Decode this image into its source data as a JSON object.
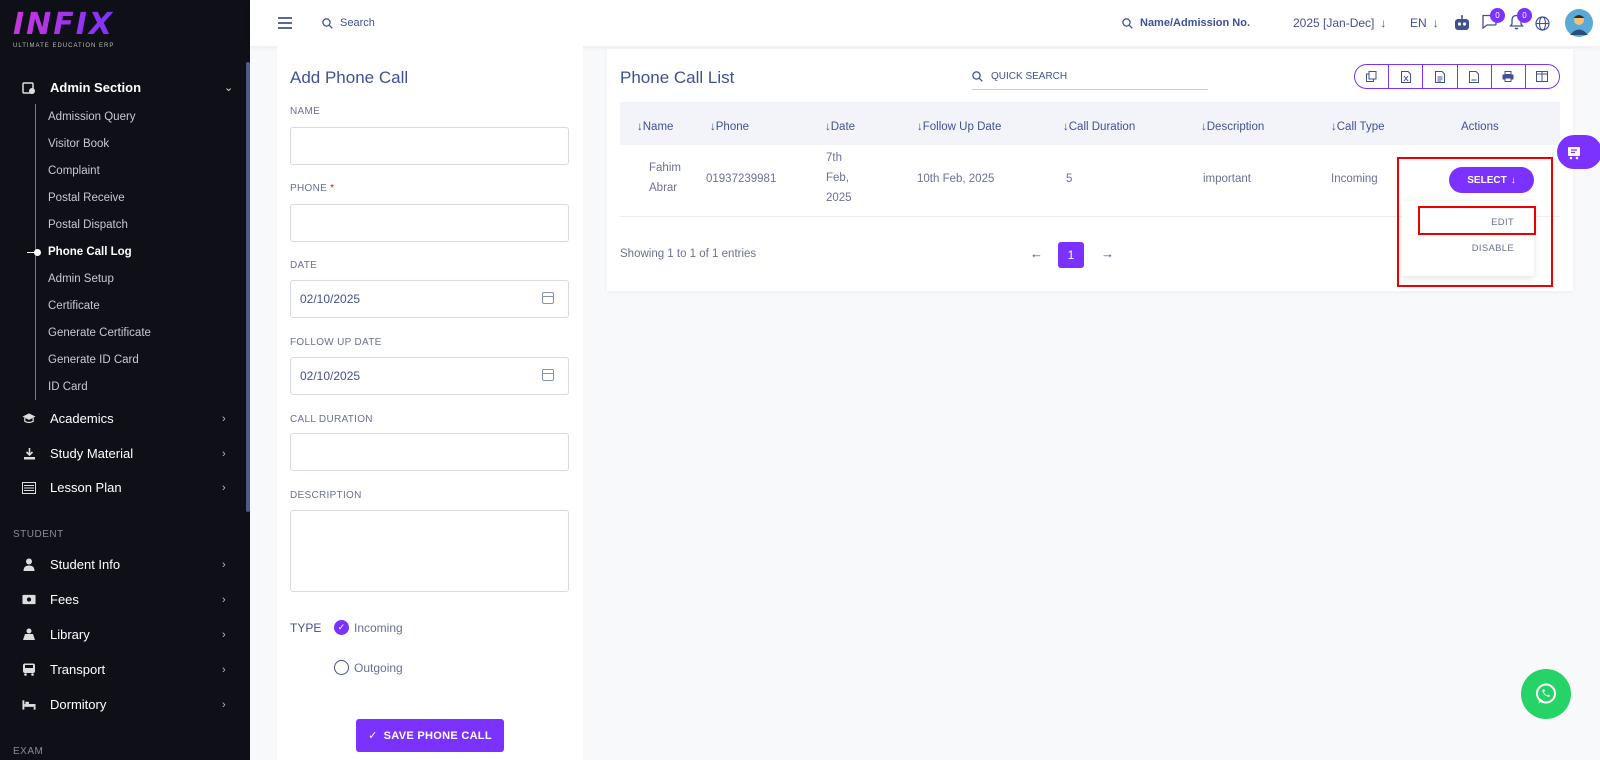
{
  "brand": {
    "logo_text": "INFIX",
    "tagline": "ULTIMATE EDUCATION ERP"
  },
  "sidebar": {
    "admin_section": "Admin Section",
    "admin_items": [
      "Admission Query",
      "Visitor Book",
      "Complaint",
      "Postal Receive",
      "Postal Dispatch",
      "Phone Call Log",
      "Admin Setup",
      "Certificate",
      "Generate Certificate",
      "Generate ID Card",
      "ID Card"
    ],
    "active_item": "Phone Call Log",
    "academics": "Academics",
    "study_material": "Study Material",
    "lesson_plan": "Lesson Plan",
    "student_label": "STUDENT",
    "student_info": "Student Info",
    "fees": "Fees",
    "library": "Library",
    "transport": "Transport",
    "dormitory": "Dormitory",
    "exam_label": "EXAM"
  },
  "topbar": {
    "search_placeholder": "Search",
    "student_search": "Name/Admission No.",
    "session": "2025 [Jan-Dec]",
    "language": "EN",
    "chat_count": "0",
    "notif_count": "0"
  },
  "form": {
    "title": "Add Phone Call",
    "name_label": "NAME",
    "phone_label": "PHONE",
    "required_mark": "*",
    "date_label": "DATE",
    "date_value": "02/10/2025",
    "follow_label": "FOLLOW UP DATE",
    "follow_value": "02/10/2025",
    "duration_label": "CALL DURATION",
    "description_label": "DESCRIPTION",
    "type_label": "TYPE",
    "type_incoming": "Incoming",
    "type_outgoing": "Outgoing",
    "save_label": "SAVE PHONE CALL"
  },
  "list": {
    "title": "Phone Call List",
    "quick_search": "QUICK SEARCH",
    "columns": [
      "Name",
      "Phone",
      "Date",
      "Follow Up Date",
      "Call Duration",
      "Description",
      "Call Type",
      "Actions"
    ],
    "row": {
      "name_line1": "Fahim",
      "name_line2": "Abrar",
      "phone": "01937239981",
      "date_l1": "7th",
      "date_l2": "Feb,",
      "date_l3": "2025",
      "follow_up": "10th Feb, 2025",
      "duration": "5",
      "description": "important",
      "call_type": "Incoming"
    },
    "select_label": "SELECT",
    "edit_label": "EDIT",
    "disable_label": "DISABLE",
    "showing": "Showing 1 to 1 of 1 entries",
    "current_page": "1"
  },
  "colors": {
    "accent": "#7c32ff",
    "text": "#415094",
    "sidebar_bg": "#0f0f17",
    "highlight": "#e00000"
  }
}
